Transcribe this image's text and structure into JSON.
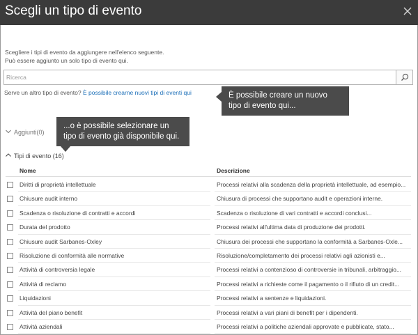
{
  "dialog": {
    "title": "Scegli un tipo di evento",
    "intro_line1": "Scegliere i tipi di evento da aggiungere nell'elenco seguente.",
    "intro_line2": "Può essere aggiunto un solo tipo di evento qui."
  },
  "search": {
    "placeholder": "Ricerca"
  },
  "new_type": {
    "prompt": "Serve un altro tipo di evento?",
    "link": "È possibile crearne nuovi tipi di eventi qui"
  },
  "callouts": {
    "create_line1": "È possibile creare un nuovo",
    "create_line2": "tipo di evento qui...",
    "select_line1": "...o è possibile selezionare un",
    "select_line2": "tipo di evento già disponibile qui."
  },
  "sections": {
    "added_label": "Aggiunti(0)",
    "types_label": "Tipi di evento (16)"
  },
  "table": {
    "headers": {
      "name": "Nome",
      "description": "Descrizione"
    },
    "rows": [
      {
        "name": "Diritti di proprietà intellettuale",
        "description": "Processi relativi alla scadenza della proprietà intellettuale, ad esempio..."
      },
      {
        "name": "Chiusure audit interno",
        "description": "Chiusura di processi che supportano audit e operazioni interne."
      },
      {
        "name": "Scadenza o risoluzione di contratti e accordi",
        "description": "Scadenza o risoluzione di vari contratti e accordi conclusi..."
      },
      {
        "name": "Durata del prodotto",
        "description": "Processi relativi all'ultima data di produzione dei prodotti."
      },
      {
        "name": "Chiusure audit Sarbanes-Oxley",
        "description": "Chiusura dei processi che supportano la conformità a Sarbanes-Oxle..."
      },
      {
        "name": "Risoluzione di conformità alle normative",
        "description": "Risoluzione/completamento dei processi relativi agli azionisti e..."
      },
      {
        "name": "Attività di controversia legale",
        "description": "Processi relativi a contenzioso di controversie in tribunali, arbitraggio..."
      },
      {
        "name": "Attività di reclamo",
        "description": "Processi relativi a richieste come il pagamento o il rifiuto di un credit..."
      },
      {
        "name": "Liquidazioni",
        "description": "Processi relativi a sentenze e liquidazioni."
      },
      {
        "name": "Attività del piano benefit",
        "description": "Processi relativi a vari piani di benefit per i dipendenti."
      },
      {
        "name": "Attività aziendali",
        "description": "Processi relativi a politiche aziendali approvate e pubblicate, stato..."
      }
    ]
  },
  "colors": {
    "header_bg": "#3b3b3b",
    "link": "#1c6fb8",
    "callout_bg": "#4b4b4b"
  },
  "icons": {
    "close": "close-icon",
    "search": "search-icon",
    "added_chevron": "chevron-down-icon",
    "types_chevron": "chevron-up-icon"
  }
}
